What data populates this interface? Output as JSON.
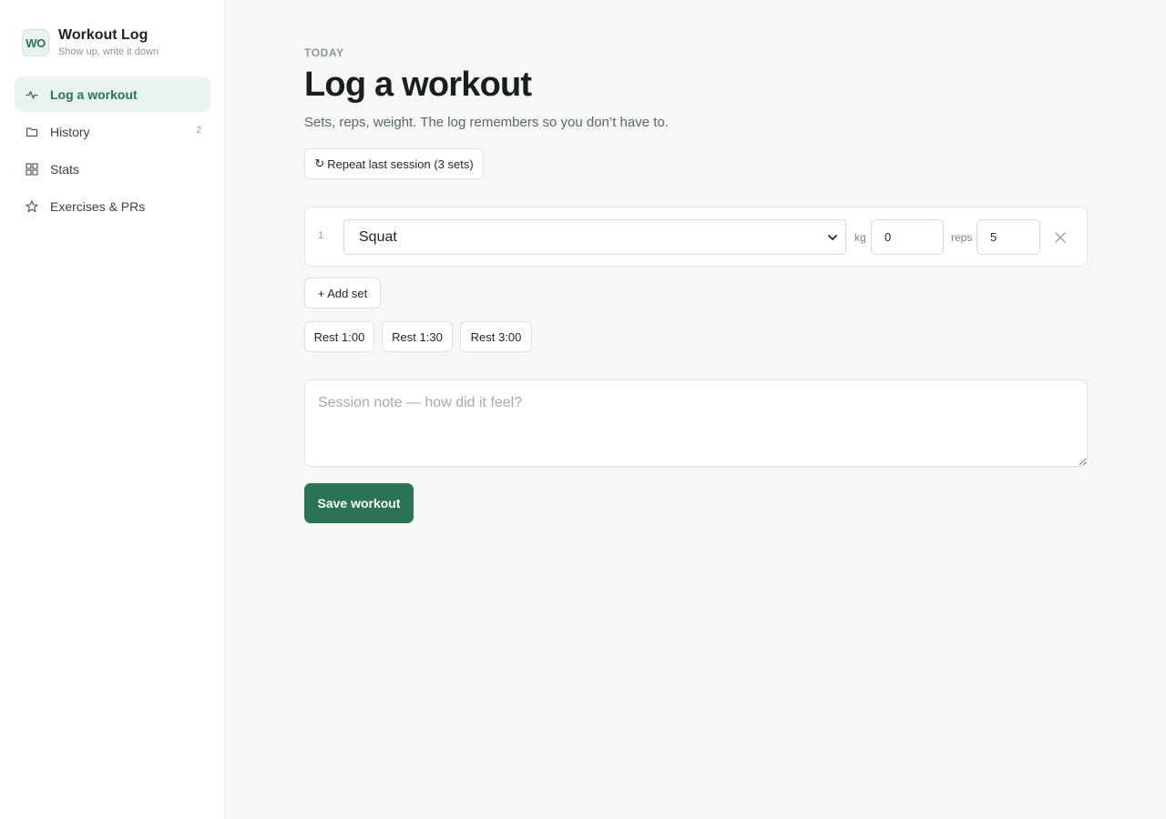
{
  "brand": {
    "logo_text": "WO",
    "title": "Workout Log",
    "subtitle": "Show up, write it down"
  },
  "sidebar": {
    "items": [
      {
        "label": "Log a workout",
        "icon": "activity-icon",
        "active": true
      },
      {
        "label": "History",
        "icon": "folder-icon",
        "count": "2"
      },
      {
        "label": "Stats",
        "icon": "grid-icon"
      },
      {
        "label": "Exercises & PRs",
        "icon": "star-icon"
      }
    ]
  },
  "header": {
    "eyebrow": "TODAY",
    "title": "Log a workout",
    "subtitle": "Sets, reps, weight. The log remembers so you don’t have to."
  },
  "actions": {
    "repeat_glyph": "↻",
    "repeat_label": "Repeat last session (3 sets)",
    "add_set_label": "+ Add set",
    "rest_options": [
      "Rest 1:00",
      "Rest 1:30",
      "Rest 3:00"
    ],
    "save_label": "Save workout"
  },
  "sets": [
    {
      "number": "1",
      "exercise": "Squat",
      "weight_unit": "kg",
      "weight": "0",
      "reps_unit": "reps",
      "reps": "5"
    }
  ],
  "note": {
    "placeholder": "Session note — how did it feel?",
    "value": ""
  },
  "colors": {
    "accent": "#2a7354",
    "accent_bg": "#eaf4ef",
    "page_bg": "#f6f8f7"
  }
}
